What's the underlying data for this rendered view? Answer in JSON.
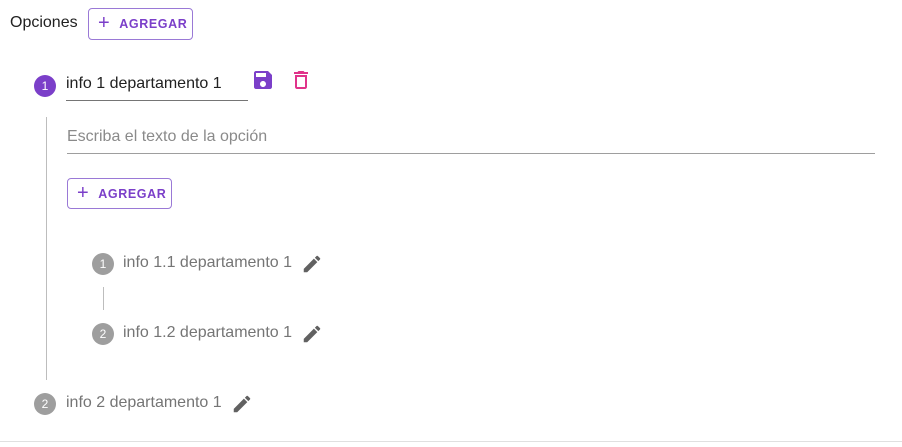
{
  "header": {
    "title": "Opciones",
    "add_label": "AGREGAR"
  },
  "steps": [
    {
      "number": "1",
      "title_value": "info 1 departamento 1",
      "option_placeholder": "Escriba el texto de la opción",
      "add_label": "AGREGAR",
      "substeps": [
        {
          "number": "1",
          "label": "info 1.1 departamento 1"
        },
        {
          "number": "2",
          "label": "info 1.2 departamento 1"
        }
      ]
    },
    {
      "number": "2",
      "label": "info 2 departamento 1"
    }
  ],
  "icons": {
    "add": "plus-icon",
    "save": "save-icon",
    "delete": "trash-icon",
    "edit": "pencil-icon"
  },
  "colors": {
    "accent": "#7b3fc9",
    "delete": "#e0338a",
    "inactive": "#9e9e9e",
    "icon": "#616161"
  }
}
